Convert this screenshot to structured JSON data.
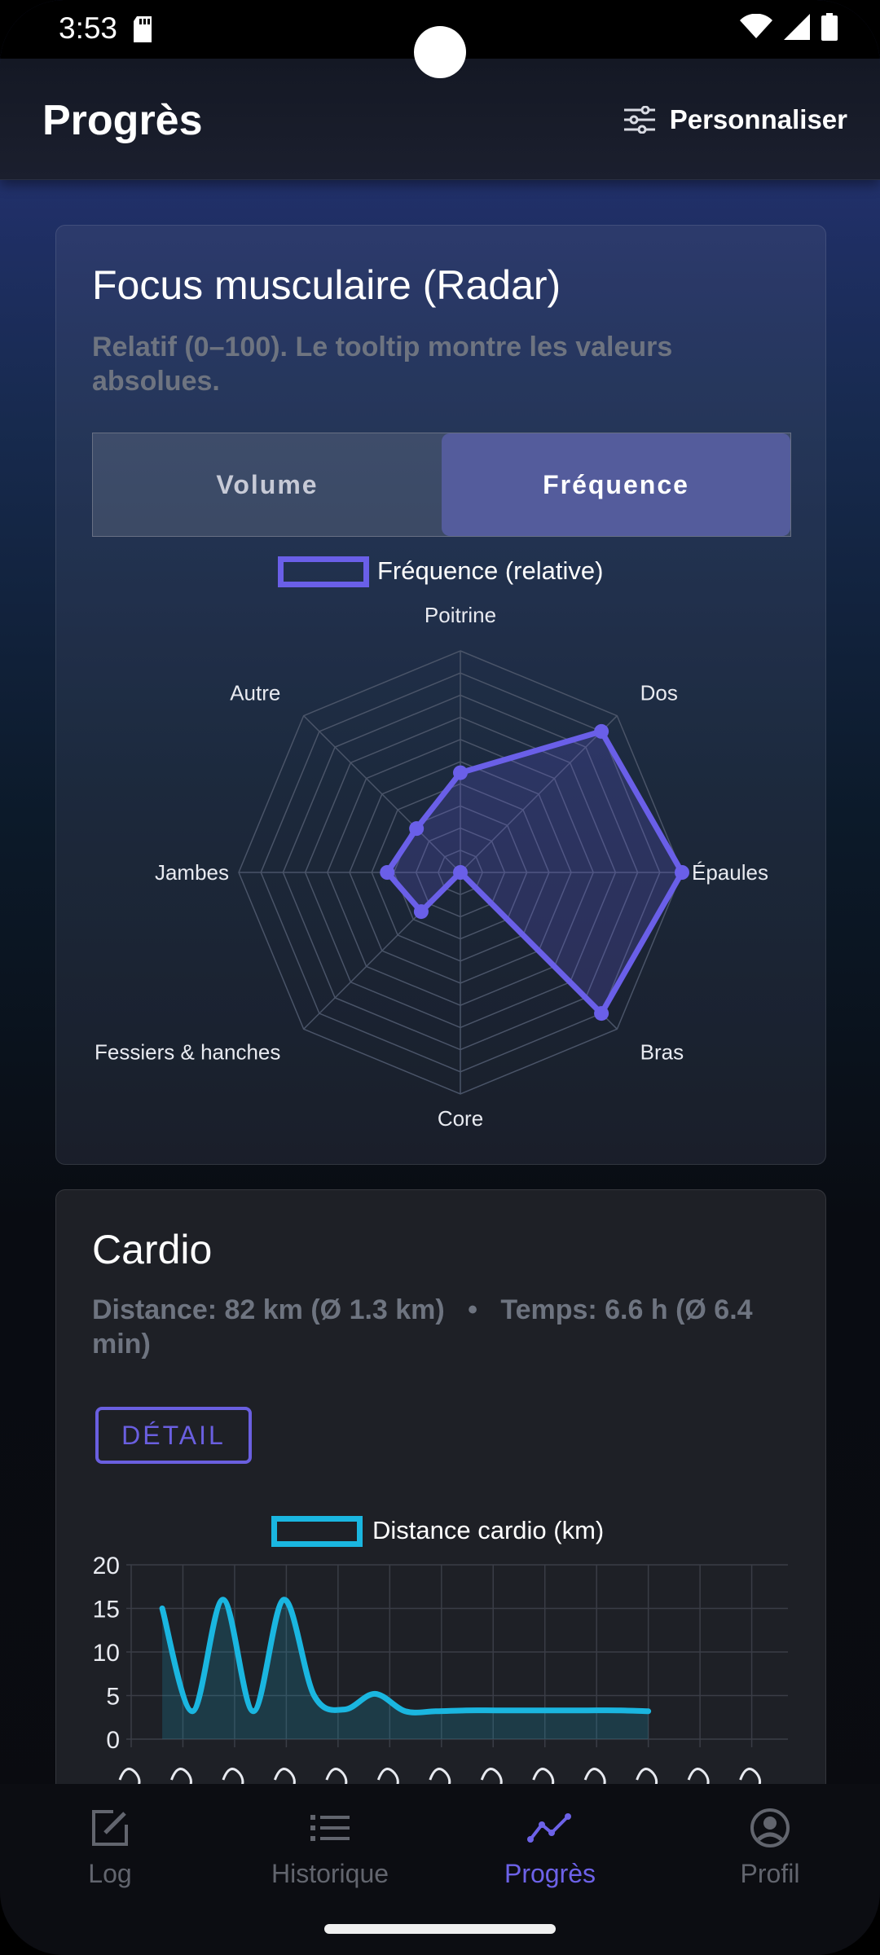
{
  "status_bar": {
    "time": "3:53"
  },
  "header": {
    "title": "Progrès",
    "customize_label": "Personnaliser"
  },
  "radar_card": {
    "title": "Focus musculaire (Radar)",
    "subtitle_line1": "Relatif (0–100). Le tooltip montre les valeurs",
    "subtitle_line2": "absolues.",
    "tabs": [
      {
        "label": "Volume",
        "selected": false
      },
      {
        "label": "Fréquence",
        "selected": true
      }
    ]
  },
  "cardio_card": {
    "title": "Cardio",
    "summary_line1": "Distance: 82 km (Ø 1.3 km)   •   Temps: 6.6 h (Ø 6.4",
    "summary_line2": "min)",
    "detail_label": "DÉTAIL"
  },
  "chart_data": [
    {
      "type": "radar",
      "legend": "Fréquence (relative)",
      "color": "#6a5fe8",
      "categories": [
        "Poitrine",
        "Dos",
        "Épaules",
        "Bras",
        "Core",
        "Fessiers & hanches",
        "Jambes",
        "Autre"
      ],
      "values": [
        45,
        90,
        100,
        90,
        0,
        25,
        33,
        28
      ],
      "range": [
        0,
        100
      ]
    },
    {
      "type": "line",
      "legend": "Distance cardio (km)",
      "color": "#1ab6e0",
      "y_ticks": [
        0,
        5,
        10,
        15,
        20
      ],
      "ylim": [
        0,
        20
      ],
      "values": [
        15,
        3.2,
        16,
        3.2,
        16,
        5,
        3.4,
        5.2,
        3.2,
        3.2,
        3.3,
        3.3,
        3.3,
        3.3,
        3.3,
        3.3,
        3.2
      ],
      "x_tick_count": 13,
      "grid": true
    }
  ],
  "bottom_nav": [
    {
      "label": "Log",
      "icon": "edit-icon",
      "active": false
    },
    {
      "label": "Historique",
      "icon": "list-icon",
      "active": false
    },
    {
      "label": "Progrès",
      "icon": "trend-icon",
      "active": true
    },
    {
      "label": "Profil",
      "icon": "account-icon",
      "active": false
    }
  ]
}
